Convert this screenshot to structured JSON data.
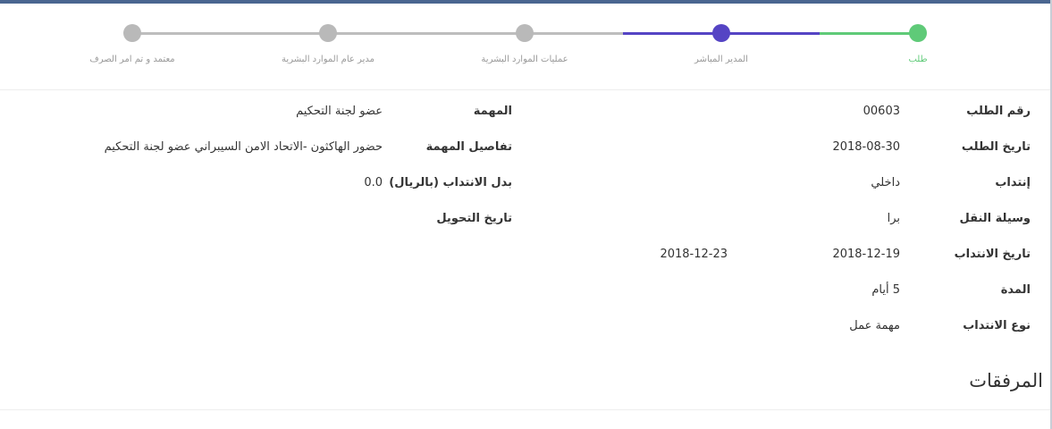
{
  "stepper": {
    "steps": [
      {
        "label": "طلب",
        "state": "done",
        "color": "#5fca78"
      },
      {
        "label": "المدير المباشر",
        "state": "current",
        "color": "#5544c4"
      },
      {
        "label": "عمليات الموارد البشرية",
        "state": "pending",
        "color": "#b9b9b9"
      },
      {
        "label": "مدير عام الموارد البشرية",
        "state": "pending",
        "color": "#b9b9b9"
      },
      {
        "label": "معتمد و تم امر الصرف",
        "state": "pending",
        "color": "#b9b9b9"
      }
    ]
  },
  "details": {
    "request_number_label": "رقم الطلب",
    "request_number": "00603",
    "request_date_label": "تاريخ الطلب",
    "request_date": "2018-08-30",
    "delegation_label": "إنتداب",
    "delegation": "داخلي",
    "transport_label": "وسيلة النقل",
    "transport": "برا",
    "delegation_date_label": "تاريخ الانتداب",
    "delegation_start": "2018-12-19",
    "delegation_end": "2018-12-23",
    "duration_label": "المدة",
    "duration": "5 أيام",
    "delegation_type_label": "نوع الانتداب",
    "delegation_type": "مهمة عمل",
    "task_label": "المهمة",
    "task": "عضو لجنة التحكيم",
    "task_details_label": "تفاصيل المهمة",
    "task_details": "حضور الهاكثون -الاتحاد الامن السيبراني عضو لجنة التحكيم",
    "allowance_label": "بدل الانتداب (بالريال)",
    "allowance": "0.0",
    "transfer_date_label": "تاريخ التحويل",
    "transfer_date": ""
  },
  "attachments": {
    "title": "المرفقات"
  }
}
